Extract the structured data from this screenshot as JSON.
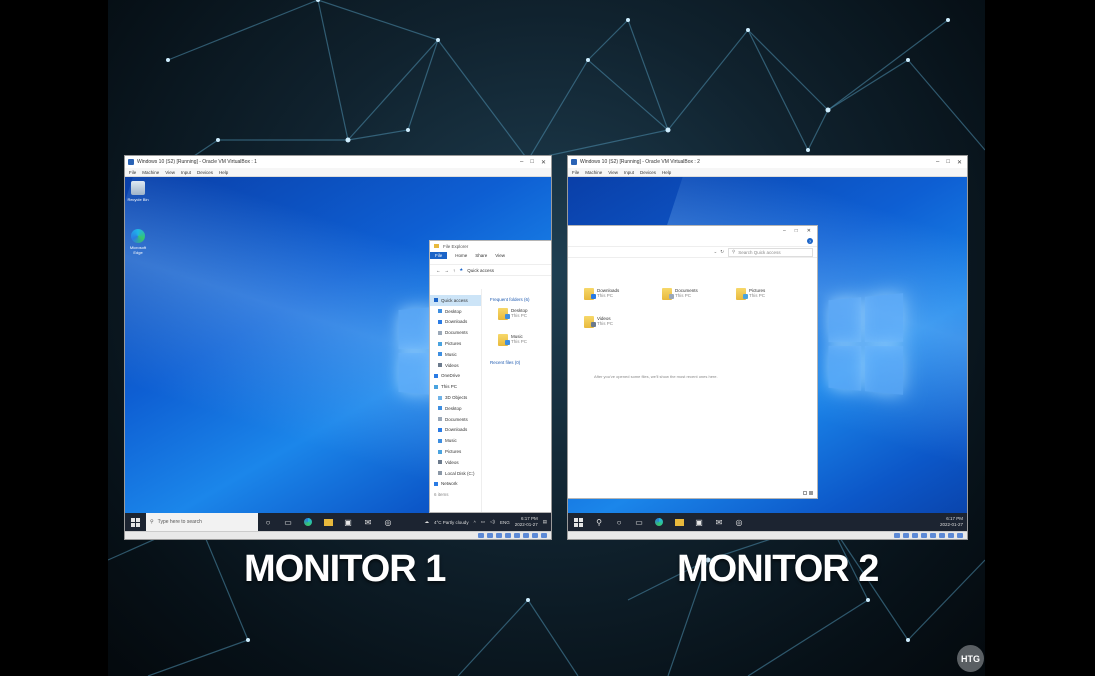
{
  "monitor1": {
    "label": "MONITOR 1",
    "vm_title": "Windows 10 (S2) [Running] - Oracle VM VirtualBox : 1",
    "vm_menu": [
      "File",
      "Machine",
      "View",
      "Input",
      "Devices",
      "Help"
    ],
    "desktop_icons": [
      {
        "label": "Recycle Bin",
        "icon": "recycle-bin-icon"
      },
      {
        "label": "Microsoft Edge",
        "icon": "edge-icon"
      }
    ],
    "explorer": {
      "title": "File Explorer",
      "ribbon": [
        "File",
        "Home",
        "Share",
        "View"
      ],
      "address": "Quick access",
      "nav": [
        "Quick access",
        "Desktop",
        "Downloads",
        "Documents",
        "Pictures",
        "Music",
        "Videos",
        "OneDrive",
        "This PC",
        "3D Objects",
        "Desktop",
        "Documents",
        "Downloads",
        "Music",
        "Pictures",
        "Videos",
        "Local Disk (C:)",
        "Network"
      ],
      "frequent_header": "Frequent folders (6)",
      "folders": [
        {
          "name": "Desktop",
          "location": "This PC"
        },
        {
          "name": "Music",
          "location": "This PC"
        }
      ],
      "recent_header": "Recent files (0)",
      "status": "6 items"
    },
    "taskbar": {
      "search_placeholder": "Type here to search",
      "weather": "4°C  Partly cloudy",
      "lang": "ENG",
      "time": "6:17 PM",
      "date": "2022-01-27"
    }
  },
  "monitor2": {
    "label": "MONITOR 2",
    "vm_title": "Windows 10 (S2) [Running] - Oracle VM VirtualBox : 2",
    "vm_menu": [
      "File",
      "Machine",
      "View",
      "Input",
      "Devices",
      "Help"
    ],
    "explorer": {
      "search_placeholder": "Search Quick access",
      "folders": [
        {
          "name": "Downloads",
          "location": "This PC"
        },
        {
          "name": "Documents",
          "location": "This PC"
        },
        {
          "name": "Pictures",
          "location": "This PC"
        },
        {
          "name": "Videos",
          "location": "This PC"
        }
      ],
      "empty_message": "After you've opened some files, we'll show the most recent ones here."
    },
    "taskbar": {
      "time": "6:17 PM",
      "date": "2022-01-27"
    }
  },
  "watermark": "HTG",
  "colors": {
    "desktop_blue": "#0e5fd3",
    "taskbar": "#1c2431",
    "file_tab": "#1b64c8"
  }
}
